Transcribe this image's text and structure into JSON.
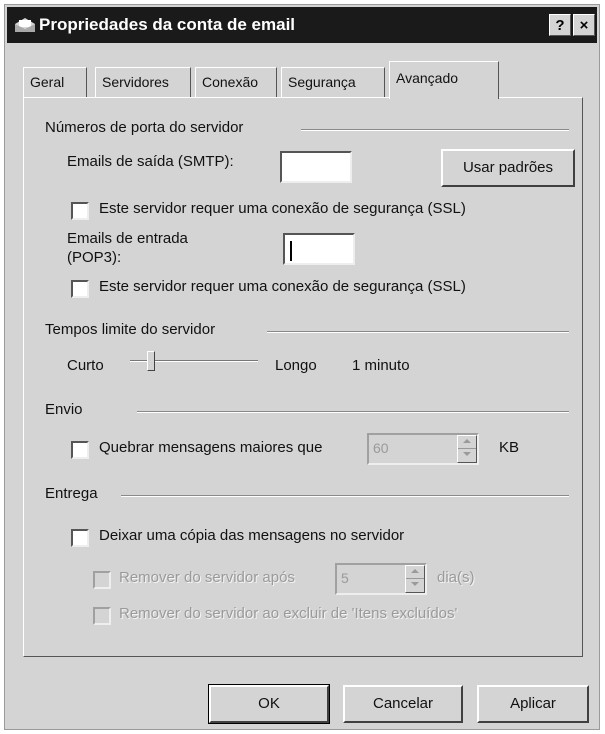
{
  "window": {
    "title": "Propriedades da conta de email",
    "help_button": "?",
    "close_button": "×"
  },
  "tabs": [
    {
      "label": "Geral"
    },
    {
      "label": "Servidores"
    },
    {
      "label": "Conexão"
    },
    {
      "label": "Segurança"
    },
    {
      "label": "Avançado",
      "active": true
    }
  ],
  "ports": {
    "group_title": "Números de porta do servidor",
    "smtp_label": "Emails de saída (SMTP):",
    "smtp_value": "",
    "use_defaults_button": "Usar padrões",
    "ssl_smtp_label": "Este servidor requer uma conexão de segurança (SSL)",
    "ssl_smtp_checked": false,
    "pop3_label_line1": "Emails de entrada",
    "pop3_label_line2": "(POP3):",
    "pop3_value": "",
    "ssl_pop3_label": "Este servidor requer uma conexão de segurança (SSL)",
    "ssl_pop3_checked": false
  },
  "timeouts": {
    "group_title": "Tempos limite do servidor",
    "short_label": "Curto",
    "long_label": "Longo",
    "value_label": "1 minuto",
    "slider_fraction": 0.15
  },
  "sending": {
    "group_title": "Envio",
    "break_label": "Quebrar mensagens maiores que",
    "break_checked": false,
    "break_value": "60",
    "unit": "KB"
  },
  "delivery": {
    "group_title": "Entrega",
    "leave_copy_label": "Deixar uma cópia das mensagens no servidor",
    "leave_copy_checked": false,
    "remove_after_label": "Remover do servidor após",
    "remove_after_value": "5",
    "days_label": "dia(s)",
    "remove_deleted_label": "Remover do servidor ao excluir de 'Itens excluídos'"
  },
  "footer": {
    "ok": "OK",
    "cancel": "Cancelar",
    "apply": "Aplicar"
  }
}
